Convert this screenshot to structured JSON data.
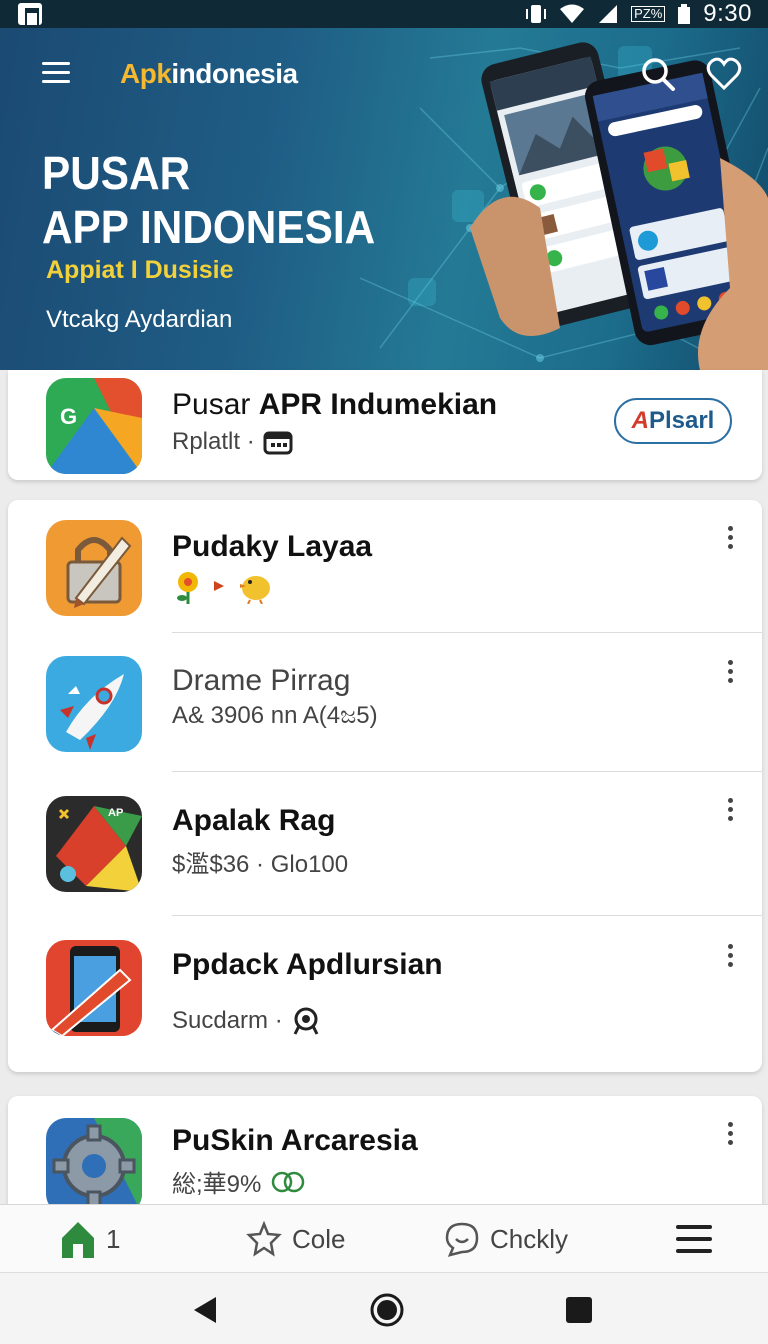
{
  "status_bar": {
    "battery_text": "PZ%",
    "time": "9:30"
  },
  "header": {
    "brand_accent": "Apk",
    "brand_rest": "indonesia",
    "title_line1": "PUSAR",
    "title_line2": "APP INDONESIA",
    "subtitle": "Appiat I Dusisie",
    "caption": "Vtcakg Aydardian"
  },
  "featured": {
    "title_prefix": "Pusar",
    "title_main": "APR Indumekian",
    "subtitle": "Rplatlt ·",
    "button_accent": "A",
    "button_rest": "Plsarl"
  },
  "apps": [
    {
      "title": "Pudaky Layaa",
      "subtitle": ""
    },
    {
      "title": "Drame Pirrag",
      "subtitle": "A& 3906 nn A(4ಜ5)"
    },
    {
      "title": "Apalak Rag",
      "subtitle": "$濫$36 · Glo100"
    },
    {
      "title": "Ppdack Apdlursian",
      "subtitle": "Sucdarm ·"
    },
    {
      "title": "PuSkin Arcaresia",
      "subtitle": "総;華9%"
    }
  ],
  "bottom_nav": [
    {
      "label": "1",
      "icon": "home-icon"
    },
    {
      "label": "Cole",
      "icon": "star-icon"
    },
    {
      "label": "Chckly",
      "icon": "chat-icon"
    },
    {
      "label": "",
      "icon": "menu-icon"
    }
  ],
  "colors": {
    "accent_green": "#2e8b3e",
    "brand_yellow": "#f5b82e",
    "button_blue": "#2b6fa3"
  }
}
